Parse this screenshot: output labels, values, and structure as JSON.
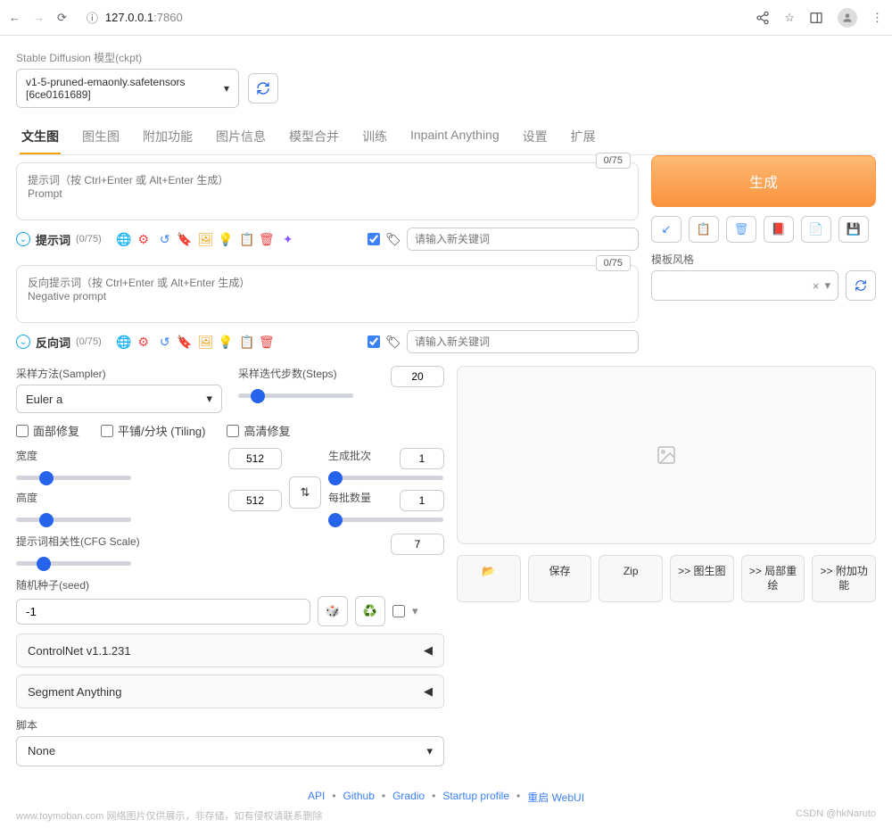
{
  "browser": {
    "url_host": "127.0.0.1",
    "url_port": ":7860"
  },
  "model": {
    "label": "Stable Diffusion 模型(ckpt)",
    "selected": "v1-5-pruned-emaonly.safetensors [6ce0161689]"
  },
  "tabs": {
    "items": [
      "文生图",
      "图生图",
      "附加功能",
      "图片信息",
      "模型合并",
      "训练",
      "Inpaint Anything",
      "设置",
      "扩展"
    ],
    "active": 0
  },
  "prompt": {
    "placeholder": "提示词（按 Ctrl+Enter 或 Alt+Enter 生成）\nPrompt",
    "token_badge": "0/75",
    "toolbar_label": "提示词",
    "toolbar_count": "(0/75)",
    "keyword_placeholder": "请输入新关键词"
  },
  "neg_prompt": {
    "placeholder": "反向提示词（按 Ctrl+Enter 或 Alt+Enter 生成）\nNegative prompt",
    "token_badge": "0/75",
    "toolbar_label": "反向词",
    "toolbar_count": "(0/75)",
    "keyword_placeholder": "请输入新关键词"
  },
  "generate": {
    "button": "生成",
    "style_label": "模板风格"
  },
  "sampler": {
    "label": "采样方法(Sampler)",
    "value": "Euler a",
    "steps_label": "采样迭代步数(Steps)",
    "steps_value": "20"
  },
  "checkboxes": {
    "face": "面部修复",
    "tiling": "平铺/分块 (Tiling)",
    "hires": "高清修复"
  },
  "dims": {
    "width_label": "宽度",
    "width_value": "512",
    "height_label": "高度",
    "height_value": "512",
    "batch_count_label": "生成批次",
    "batch_count_value": "1",
    "batch_size_label": "每批数量",
    "batch_size_value": "1"
  },
  "cfg": {
    "label": "提示词相关性(CFG Scale)",
    "value": "7"
  },
  "seed": {
    "label": "随机种子(seed)",
    "value": "-1"
  },
  "accordions": {
    "controlnet": "ControlNet v1.1.231",
    "segment": "Segment Anything"
  },
  "script": {
    "label": "脚本",
    "value": "None"
  },
  "output": {
    "buttons": [
      "📂",
      "保存",
      "Zip",
      ">> 图生图",
      ">> 局部重绘",
      ">> 附加功能"
    ]
  },
  "footer": {
    "links": [
      "API",
      "Github",
      "Gradio",
      "Startup profile",
      "重启 WebUI"
    ]
  },
  "watermark": {
    "left": "www.toymoban.com  网络图片仅供展示，非存储，如有侵权请联系删除",
    "right": "CSDN @hkNaruto"
  }
}
